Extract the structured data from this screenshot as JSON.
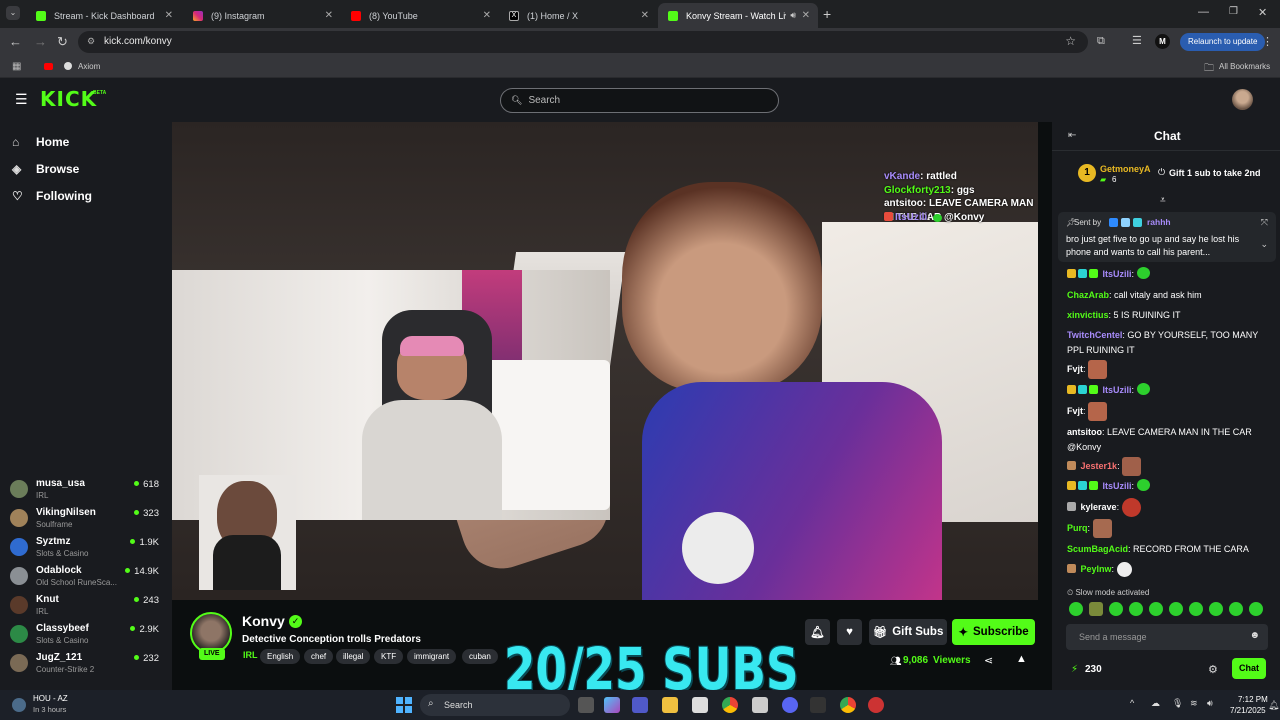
{
  "browser": {
    "tabs": [
      {
        "label": "Stream - Kick Dashboard",
        "icon": "kick-icon",
        "color": "#53fc18"
      },
      {
        "label": "(9) Instagram",
        "icon": "instagram-icon",
        "color": "#d62976"
      },
      {
        "label": "(8) YouTube",
        "icon": "youtube-icon",
        "color": "#ff0000"
      },
      {
        "label": "(1) Home / X",
        "icon": "x-icon",
        "color": "#ffffff"
      },
      {
        "label": "Konvy Stream - Watch Live",
        "icon": "kick-icon",
        "color": "#53fc18"
      }
    ],
    "url": "kick.com/konvy",
    "profile_initial": "M",
    "relaunch_label": "Relaunch to update",
    "bookmark_axiom": "Axiom",
    "all_bookmarks": "All Bookmarks"
  },
  "kick": {
    "logo": "KICK",
    "logo_beta": "BETA",
    "brand_color": "#53fc18",
    "search_placeholder": "Search",
    "nav": [
      {
        "label": "Home",
        "icon": "home-icon"
      },
      {
        "label": "Browse",
        "icon": "compass-icon"
      },
      {
        "label": "Following",
        "icon": "heart-icon"
      }
    ],
    "recommended": [
      {
        "name": "musa_usa",
        "category": "IRL",
        "viewers": "618"
      },
      {
        "name": "VikingNilsen",
        "category": "Soulframe",
        "viewers": "323"
      },
      {
        "name": "Syztmz",
        "category": "Slots & Casino",
        "viewers": "1.9K"
      },
      {
        "name": "Odablock",
        "category": "Old School RuneSca...",
        "viewers": "14.9K"
      },
      {
        "name": "Knut",
        "category": "IRL",
        "viewers": "243"
      },
      {
        "name": "Classybeef",
        "category": "Slots & Casino",
        "viewers": "2.9K"
      },
      {
        "name": "JugZ_121",
        "category": "Counter-Strike 2",
        "viewers": "232"
      }
    ]
  },
  "overlay_chat": [
    {
      "user": "vKande",
      "text": "rattled",
      "color": "#a78bfa"
    },
    {
      "user": "Glockforty213",
      "text": "ggs",
      "color": "#53fc18"
    },
    {
      "user": "antsitoo",
      "text": "LEAVE CAMERA MAN IN THE CAR @Konvy",
      "color": "#ffffff"
    },
    {
      "user": "ItsUzili",
      "text": "",
      "color": "#a78bfa"
    }
  ],
  "stream": {
    "channel": "Konvy",
    "title": "Detective Conception trolls Predators",
    "live_label": "LIVE",
    "category": "IRL",
    "tags": [
      "English",
      "chef",
      "illegal",
      "KTF",
      "immigrant",
      "cuban"
    ],
    "viewers": "9,086",
    "viewers_label": "Viewers",
    "gift_subs_label": "Gift Subs",
    "subscribe_label": "Subscribe",
    "sub_goal": "20/25 SUBS"
  },
  "chat": {
    "title": "Chat",
    "leader": {
      "rank": "1",
      "name": "GetmoneyA",
      "count": "6",
      "gift_label": "Gift 1 sub to take 2nd"
    },
    "pinned": {
      "sent_by_label": "Sent by",
      "sender": "rahhh",
      "text": "bro just get five to go up and say he lost his phone and wants to call his parent..."
    },
    "messages": [
      {
        "user": "ItsUzili",
        "text": "",
        "color": "#a78bfa",
        "kind": "bubble"
      },
      {
        "user": "ChazArab",
        "text": "call vitaly and ask him",
        "color": "#53fc18"
      },
      {
        "user": "xinvictius",
        "text": "5 IS RUINING IT",
        "color": "#53fc18"
      },
      {
        "user": "TwitchCentel",
        "text": "GO BY YOURSELF, TOO MANY PPL RUINING IT",
        "color": "#a78bfa"
      },
      {
        "user": "Fvjt",
        "text": "",
        "color": "#ffffff",
        "kind": "emote"
      },
      {
        "user": "ItsUzili",
        "text": "",
        "color": "#a78bfa",
        "kind": "bubble"
      },
      {
        "user": "Fvjt",
        "text": "",
        "color": "#ffffff",
        "kind": "emote"
      },
      {
        "user": "antsitoo",
        "text": "LEAVE CAMERA MAN IN THE CAR @Konvy",
        "color": "#ffffff"
      },
      {
        "user": "Jester1k",
        "text": "",
        "color": "#f87171",
        "kind": "emote"
      },
      {
        "user": "ItsUzili",
        "text": "",
        "color": "#a78bfa",
        "kind": "bubble"
      },
      {
        "user": "kylerave",
        "text": "",
        "color": "#ffffff",
        "kind": "emote"
      },
      {
        "user": "Purq",
        "text": "",
        "color": "#53fc18",
        "kind": "emote"
      },
      {
        "user": "ScumBagAcid",
        "text": "RECORD FROM THE CARA",
        "color": "#53fc18"
      },
      {
        "user": "Peylnw",
        "text": "",
        "color": "#53fc18",
        "kind": "sticker"
      }
    ],
    "slow_mode": "Slow mode activated",
    "input_placeholder": "Send a message",
    "points": "230",
    "send_label": "Chat"
  },
  "taskbar": {
    "weather_temp": "HOU - AZ",
    "weather_sub": "In 3 hours",
    "search_label": "Search",
    "time": "7:12 PM",
    "date": "7/21/2025"
  }
}
